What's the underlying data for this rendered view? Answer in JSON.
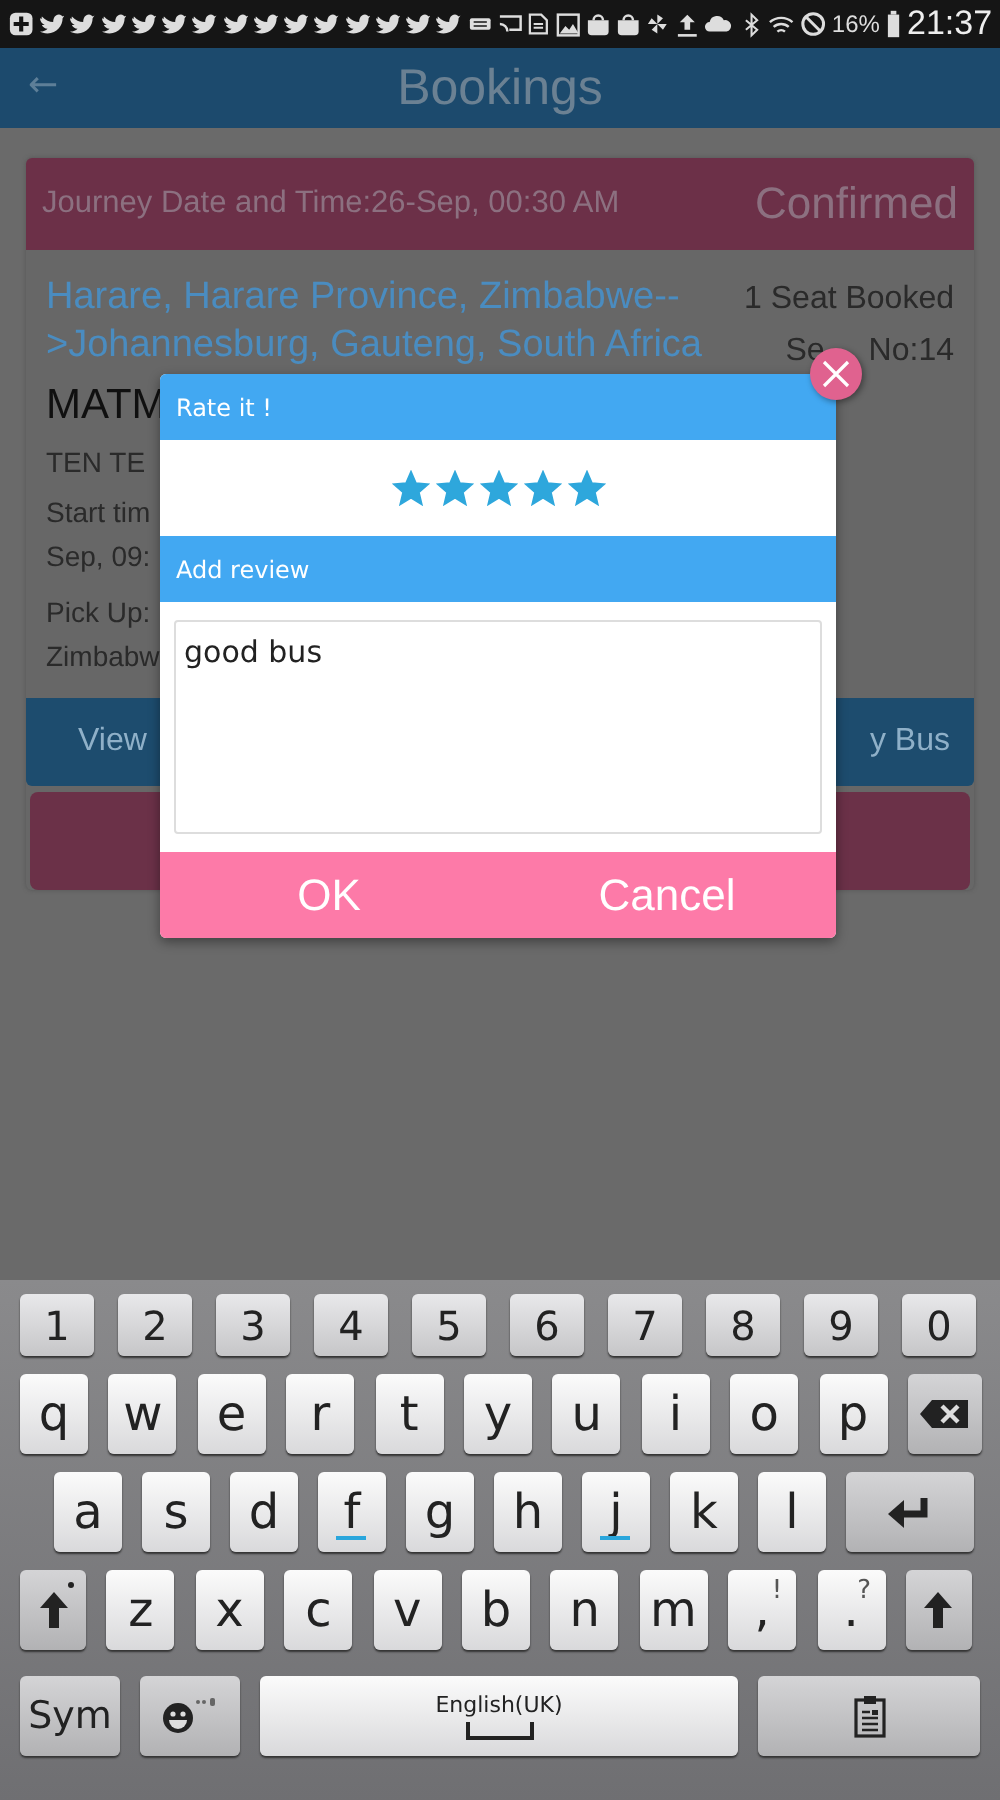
{
  "status_bar": {
    "battery": "16%",
    "time": "21:37"
  },
  "app_bar": {
    "back": "←",
    "title": "Bookings"
  },
  "booking": {
    "journey": "Journey Date and Time:26-Sep, 00:30 AM",
    "status": "Confirmed",
    "route": "Harare, Harare Province, Zimbabwe-->Johannesburg, Gauteng, South Africa",
    "seats": "1 Seat Booked",
    "seat_no_start": "Se",
    "seat_no_end": "No:14",
    "bus_name": "MATM",
    "operator": "TEN TE",
    "start_time": [
      "Start tim",
      "Sep, 09:"
    ],
    "pickup": [
      "Pick Up:",
      "Zimbabw"
    ],
    "buttons": [
      "View",
      "y Bus"
    ]
  },
  "dialog": {
    "rating_title": "Rate it !",
    "stars": 5,
    "review_title": "Add review",
    "review": "good bus",
    "buttons": [
      "OK",
      "Cancel"
    ]
  },
  "keyboard": {
    "rows": [
      {
        "keys": [
          {
            "kind": "char",
            "label": "1"
          },
          {
            "kind": "char",
            "label": "2"
          },
          {
            "kind": "char",
            "label": "3"
          },
          {
            "kind": "char",
            "label": "4"
          },
          {
            "kind": "char",
            "label": "5"
          },
          {
            "kind": "char",
            "label": "6"
          },
          {
            "kind": "char",
            "label": "7"
          },
          {
            "kind": "char",
            "label": "8"
          },
          {
            "kind": "char",
            "label": "9"
          },
          {
            "kind": "char",
            "label": "0"
          }
        ]
      },
      {
        "keys": [
          {
            "kind": "char",
            "label": "q"
          },
          {
            "kind": "char",
            "label": "w"
          },
          {
            "kind": "char",
            "label": "e"
          },
          {
            "kind": "char",
            "label": "r"
          },
          {
            "kind": "char",
            "label": "t"
          },
          {
            "kind": "char",
            "label": "y"
          },
          {
            "kind": "char",
            "label": "u"
          },
          {
            "kind": "char",
            "label": "i"
          },
          {
            "kind": "char",
            "label": "o"
          },
          {
            "kind": "char",
            "label": "p"
          },
          {
            "kind": "backspace"
          }
        ]
      },
      {
        "keys": [
          {
            "kind": "char",
            "label": "a"
          },
          {
            "kind": "char",
            "label": "s"
          },
          {
            "kind": "char",
            "label": "d"
          },
          {
            "kind": "home",
            "label": "f"
          },
          {
            "kind": "char",
            "label": "g"
          },
          {
            "kind": "char",
            "label": "h"
          },
          {
            "kind": "home",
            "label": "j"
          },
          {
            "kind": "char",
            "label": "k"
          },
          {
            "kind": "char",
            "label": "l"
          },
          {
            "kind": "enter"
          }
        ]
      },
      {
        "keys": [
          {
            "kind": "shift_lock"
          },
          {
            "kind": "char",
            "label": "z"
          },
          {
            "kind": "char",
            "label": "x"
          },
          {
            "kind": "char",
            "label": "c"
          },
          {
            "kind": "char",
            "label": "v"
          },
          {
            "kind": "char",
            "label": "b"
          },
          {
            "kind": "char",
            "label": "n"
          },
          {
            "kind": "char",
            "label": "m"
          },
          {
            "kind": "char",
            "label": ",",
            "alt": "!"
          },
          {
            "kind": "char",
            "label": ".",
            "alt": "?"
          },
          {
            "kind": "shift"
          }
        ]
      },
      {
        "keys": [
          {
            "kind": "mode",
            "label": "Sym"
          },
          {
            "kind": "emoji"
          },
          {
            "kind": "space",
            "label": "English(UK)"
          },
          {
            "kind": "clipboard"
          }
        ]
      }
    ]
  }
}
